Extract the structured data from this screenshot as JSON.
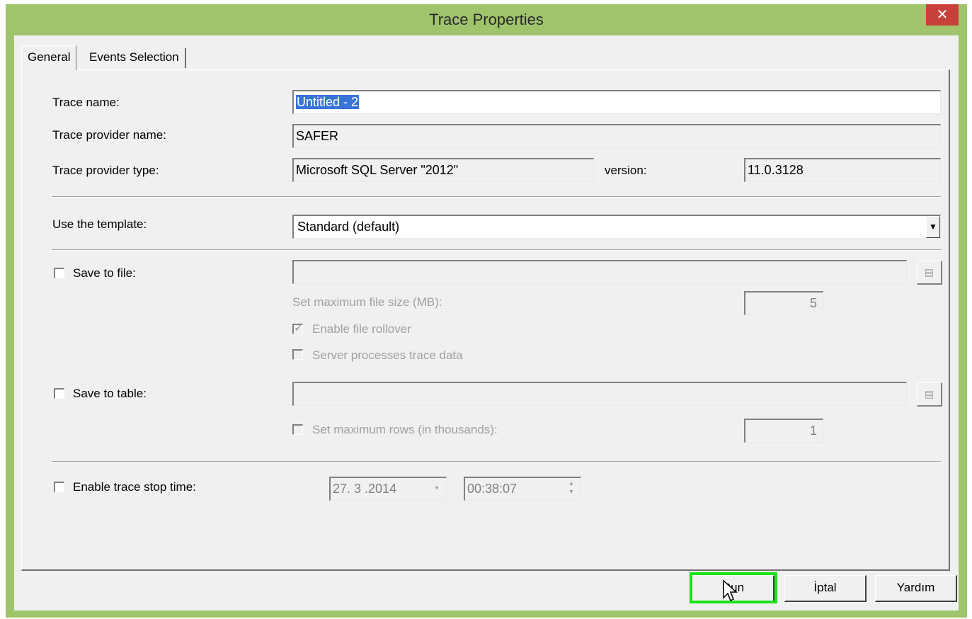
{
  "window": {
    "title": "Trace Properties",
    "close_glyph": "✕"
  },
  "tabs": [
    {
      "label": "General"
    },
    {
      "label": "Events Selection"
    }
  ],
  "fields": {
    "trace_name": {
      "label": "Trace name:",
      "value": "Untitled - 2"
    },
    "provider_name": {
      "label": "Trace provider name:",
      "value": "SAFER"
    },
    "provider_type": {
      "label": "Trace provider type:",
      "value": "Microsoft SQL Server \"2012\""
    },
    "version": {
      "label": "version:",
      "value": "11.0.3128"
    },
    "template": {
      "label": "Use the template:",
      "value": "Standard (default)"
    }
  },
  "save_to_file": {
    "label": "Save to file:",
    "max_size_label": "Set maximum file size (MB):",
    "max_size_value": "5",
    "rollover_label": "Enable file rollover",
    "server_processes_label": "Server processes trace data"
  },
  "save_to_table": {
    "label": "Save to table:",
    "max_rows_label": "Set maximum rows (in thousands):",
    "max_rows_value": "1"
  },
  "stop_time": {
    "label": "Enable trace stop time:",
    "date": "27. 3 .2014",
    "time": "00:38:07"
  },
  "buttons": {
    "run": "Run",
    "cancel": "İptal",
    "help": "Yardım"
  },
  "colors": {
    "frame": "#9fc46c",
    "close": "#c7403a",
    "highlight": "#1ae31a",
    "selection": "#3875d7"
  }
}
